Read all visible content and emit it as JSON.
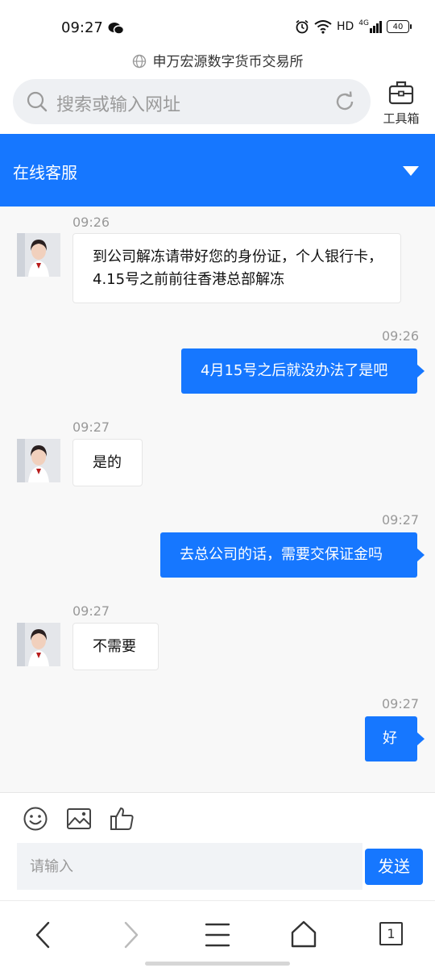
{
  "status_bar": {
    "time": "09:27",
    "network": "HD",
    "signal": "4G",
    "battery": "40"
  },
  "site": {
    "name": "申万宏源数字货币交易所"
  },
  "search": {
    "placeholder": "搜索或输入网址"
  },
  "toolbox": {
    "label": "工具箱"
  },
  "chat": {
    "title": "在线客服",
    "messages": [
      {
        "time": "09:26",
        "direction": "in",
        "text": "到公司解冻请带好您的身份证，个人银行卡，4.15号之前前往香港总部解冻"
      },
      {
        "time": "09:26",
        "direction": "out",
        "text": "4月15号之后就没办法了是吧"
      },
      {
        "time": "09:27",
        "direction": "in",
        "text": "是的"
      },
      {
        "time": "09:27",
        "direction": "out",
        "text": "去总公司的话，需要交保证金吗"
      },
      {
        "time": "09:27",
        "direction": "in",
        "text": "不需要"
      },
      {
        "time": "09:27",
        "direction": "out",
        "text": "好"
      }
    ]
  },
  "composer": {
    "placeholder": "请输入",
    "send_label": "发送"
  },
  "browser_nav": {
    "tab_count": "1"
  }
}
